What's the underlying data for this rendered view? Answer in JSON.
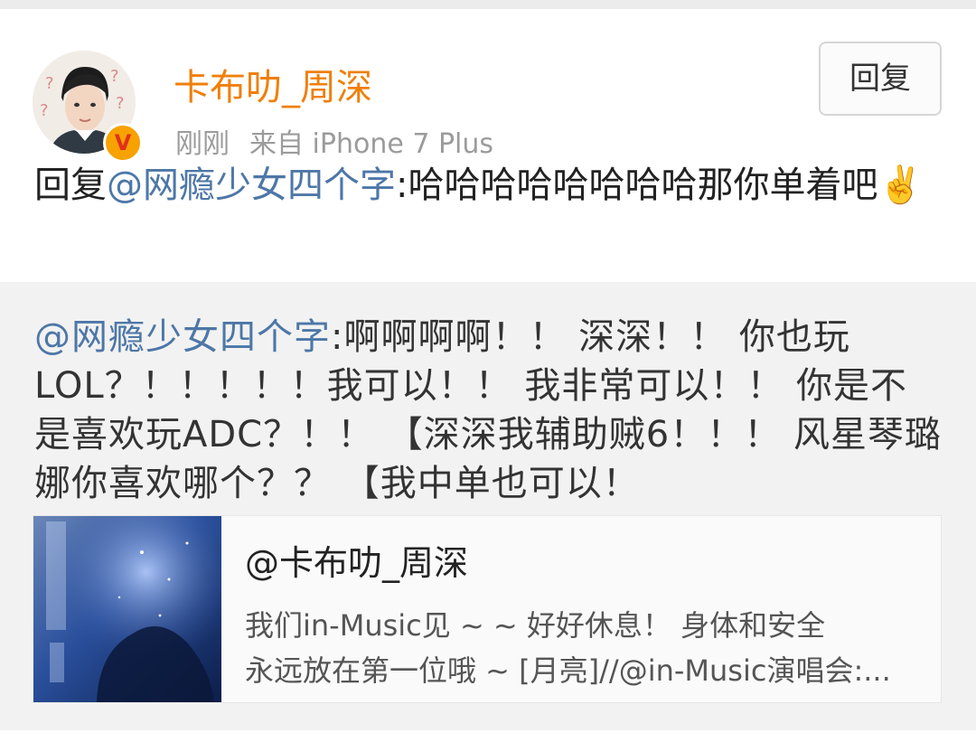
{
  "post": {
    "username": "卡布叻_周深",
    "timestamp": "刚刚",
    "source": "来自 iPhone 7 Plus",
    "reply_button": "回复",
    "verified_badge": "V",
    "text_prefix": "回复",
    "mention": "@网瘾少女四个字",
    "text_body": ":哈哈哈哈哈哈哈哈那你单着吧",
    "emoji": "✌️"
  },
  "repost": {
    "mention": "@网瘾少女四个字",
    "text": ":啊啊啊啊！！ 深深！！ 你也玩LOL？！！！！！我可以！！ 我非常可以！！ 你是不是喜欢玩ADC？！！ 【深深我辅助贼6！！！ 风星琴璐娜你喜欢哪个？？ 【我中单也可以！",
    "card": {
      "title": "@卡布叻_周深",
      "line1": "我们in-Music见 ~ ~ 好好休息！ 身体和安全",
      "line2": "永远放在第一位哦 ~ [月亮]//@in-Music演唱会:..."
    }
  },
  "colors": {
    "username": "#f07f0a",
    "mention": "#4d77a7",
    "badge": "#f7a200"
  },
  "icons": {
    "badge": "verified-v-icon",
    "emoji": "victory-hand-emoji"
  }
}
